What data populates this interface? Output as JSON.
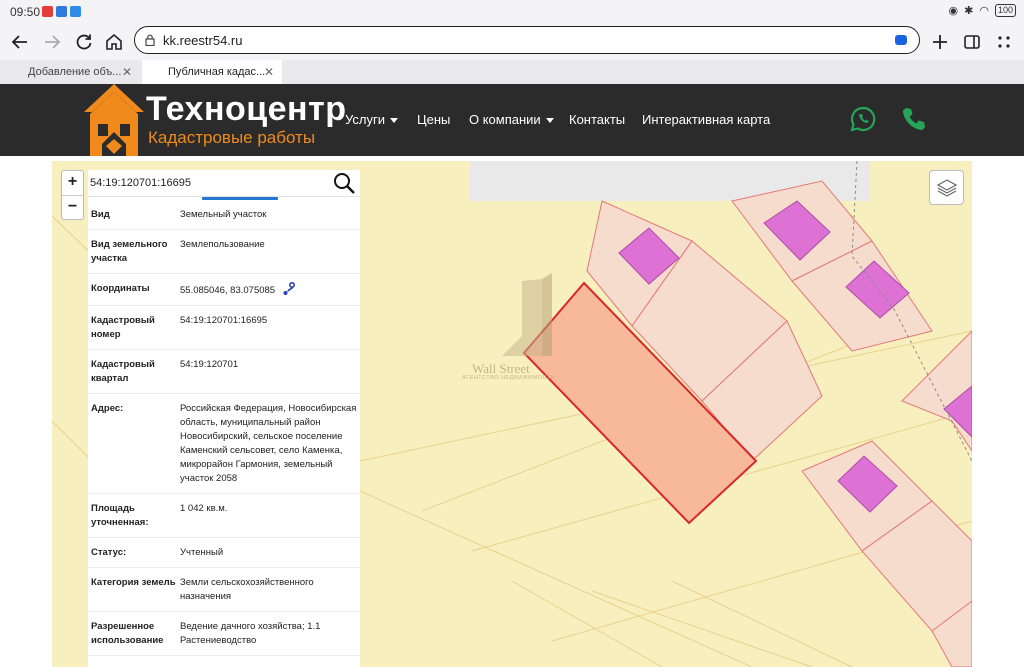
{
  "status_bar": {
    "time": "09:50",
    "battery": "100"
  },
  "browser": {
    "url": "kk.reestr54.ru",
    "tabs": [
      {
        "label": "Добавление объ..."
      },
      {
        "label": "Публичная кадас..."
      }
    ]
  },
  "site": {
    "brand_title": "Техноцентр",
    "brand_subtitle": "Кадастровые работы",
    "menu": [
      {
        "label": "Услуги"
      },
      {
        "label": "Цены"
      },
      {
        "label": "О компании"
      },
      {
        "label": "Контакты"
      },
      {
        "label": "Интерактивная карта"
      }
    ],
    "brand_colors": {
      "orange": "#f08a1c",
      "header_bg": "#2b2b2b",
      "whatsapp": "#25a55a"
    }
  },
  "map": {
    "search_value": "54:19:120701:16695",
    "zoom_in": "+",
    "zoom_out": "−",
    "watermark_title": "Wall Street",
    "watermark_sub": "АГЕНТСТВО НЕДВИЖИМОСТИ",
    "colors": {
      "background": "#f8efbe",
      "parcel": "#f7b99a",
      "parcel_border": "#d7272b",
      "building": "#dd72d4"
    }
  },
  "info": [
    {
      "key": "Вид",
      "value": "Земельный участок"
    },
    {
      "key": "Вид земельного участка",
      "value": "Землепользование"
    },
    {
      "key": "Координаты",
      "value": "55.085046, 83.075085"
    },
    {
      "key": "Кадастровый номер",
      "value": "54:19:120701:16695"
    },
    {
      "key": "Кадастровый квартал",
      "value": "54:19:120701"
    },
    {
      "key": "Адрес:",
      "value": "Российская Федерация, Новосибирская область, муниципальный район Новосибирский, сельское поселение Каменский сельсовет, село Каменка, микрорайон Гармония, земельный участок 2058"
    },
    {
      "key": "Площадь уточненная:",
      "value": "1 042 кв.м."
    },
    {
      "key": "Статус:",
      "value": "Учтенный"
    },
    {
      "key": "Категория земель",
      "value": "Земли сельскохозяйственного назначения"
    },
    {
      "key": "Разрешенное использование",
      "value": "Ведение дачного хозяйства; 1.1 Растениеводство"
    }
  ]
}
